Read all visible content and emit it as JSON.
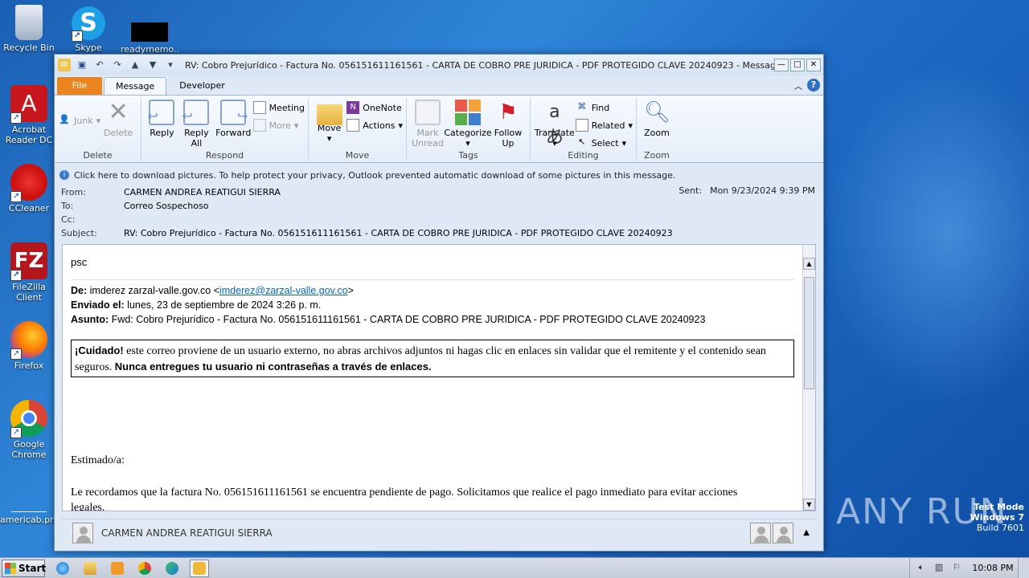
{
  "desktop": {
    "icons": [
      {
        "label": "Recycle Bin"
      },
      {
        "label": "Skype"
      },
      {
        "label": "readymemo..."
      },
      {
        "label": "Acrobat Reader DC"
      },
      {
        "label": "CCleaner"
      },
      {
        "label": "FileZilla Client"
      },
      {
        "label": "Firefox"
      },
      {
        "label": "Google Chrome"
      },
      {
        "label": "americab.png"
      }
    ],
    "watermark": "ANY RUN",
    "testmode": {
      "line1": "Test Mode",
      "line2": "Windows 7",
      "line3": "Build 7601"
    }
  },
  "window": {
    "title": "RV: Cobro Prejurídico - Factura No. 056151611161561 - CARTA DE COBRO PRE JURIDICA - PDF PROTEGIDO CLAVE 20240923  -  Message (HTM..."
  },
  "tabs": {
    "file": "File",
    "message": "Message",
    "developer": "Developer"
  },
  "ribbon": {
    "delete_group": {
      "label": "Delete",
      "junk": "Junk",
      "delete": "Delete"
    },
    "respond_group": {
      "label": "Respond",
      "reply": "Reply",
      "reply_all": "Reply All",
      "forward": "Forward",
      "meeting": "Meeting",
      "more": "More"
    },
    "move_group": {
      "label": "Move",
      "move": "Move",
      "onenote": "OneNote",
      "actions": "Actions"
    },
    "tags_group": {
      "label": "Tags",
      "mark_unread": "Mark Unread",
      "categorize": "Categorize",
      "follow_up": "Follow Up"
    },
    "editing_group": {
      "label": "Editing",
      "translate": "Translate",
      "find": "Find",
      "related": "Related",
      "select": "Select"
    },
    "zoom_group": {
      "label": "Zoom",
      "zoom": "Zoom"
    }
  },
  "infobar": "Click here to download pictures. To help protect your privacy, Outlook prevented automatic download of some pictures in this message.",
  "header": {
    "from_label": "From:",
    "from": "CARMEN ANDREA REATIGUI SIERRA",
    "to_label": "To:",
    "to": "Correo Sospechoso",
    "cc_label": "Cc:",
    "cc": "",
    "subject_label": "Subject:",
    "subject": "RV: Cobro Prejurídico - Factura No. 056151611161561 - CARTA DE COBRO PRE JURIDICA - PDF PROTEGIDO CLAVE 20240923",
    "sent_label": "Sent:",
    "sent": "Mon 9/23/2024 9:39 PM"
  },
  "body": {
    "psc": "psc",
    "de_label": "De:",
    "de_name": " imderez zarzal-valle.gov.co <",
    "de_email": "imderez@zarzal-valle.gov.co",
    "de_close": ">",
    "enviado_label": "Enviado el:",
    "enviado": " lunes, 23 de septiembre de 2024 3:26 p. m.",
    "asunto_label": "Asunto:",
    "asunto": " Fwd: Cobro Prejurídico - Factura No. 056151611161561 - CARTA DE COBRO PRE JURIDICA - PDF PROTEGIDO CLAVE 20240923",
    "warn_bold": "¡Cuidado!",
    "warn_text": " este correo proviene de un usuario externo, no abras archivos adjuntos ni hagas clic en enlaces sin validar que el remitente y el contenido sean seguros. ",
    "warn_bold2": "Nunca entregues tu usuario ni contraseñas a través de enlaces.",
    "greeting": "Estimado/a:",
    "paragraph": "Le recordamos que la factura No. 056151611161561 se encuentra pendiente de pago. Solicitamos que realice el pago inmediato para evitar acciones legales."
  },
  "people_pane": {
    "name": "CARMEN ANDREA REATIGUI SIERRA"
  },
  "taskbar": {
    "start": "Start",
    "clock": "10:08 PM"
  }
}
